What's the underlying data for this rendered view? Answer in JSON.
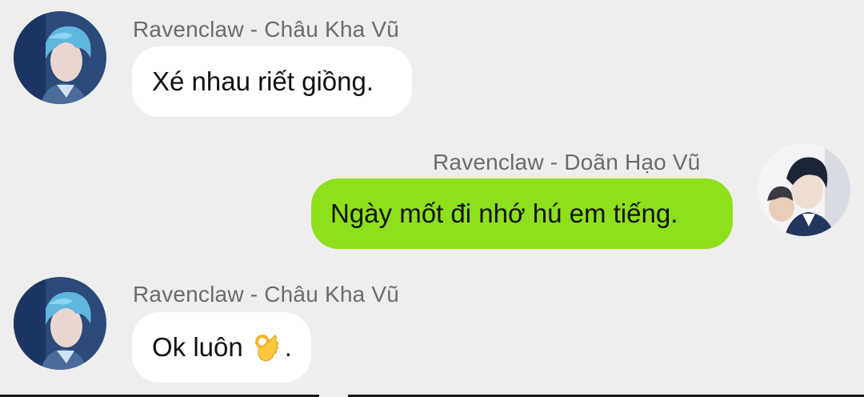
{
  "messages": [
    {
      "sender": "Ravenclaw - Châu Kha Vũ",
      "text": "Xé nhau riết giồng.",
      "direction": "incoming",
      "avatar_icon": "profile-photo-blue-hair"
    },
    {
      "sender": "Ravenclaw - Doãn Hạo Vũ",
      "text": "Ngày mốt đi nhớ hú em tiếng.",
      "direction": "outgoing",
      "avatar_icon": "profile-photo-dark-hair"
    },
    {
      "sender": "Ravenclaw - Châu Kha Vũ",
      "text_before_emoji": "Ok luôn",
      "emoji": "ok-hand-emoji",
      "text_after_emoji": ".",
      "direction": "incoming",
      "avatar_icon": "profile-photo-blue-hair"
    }
  ],
  "colors": {
    "background": "#eeeeee",
    "incoming_bubble": "#ffffff",
    "outgoing_bubble": "#8de01b",
    "sender_name": "#6b6b6b",
    "message_text": "#111111"
  }
}
